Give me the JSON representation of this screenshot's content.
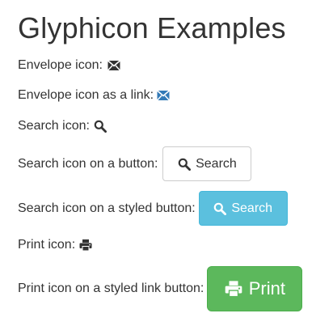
{
  "page": {
    "title": "Glyphicon Examples"
  },
  "rows": {
    "envelope": {
      "label": "Envelope icon:",
      "icon": "envelope-icon"
    },
    "envelope_link": {
      "label": "Envelope icon as a link:",
      "icon": "envelope-icon"
    },
    "search": {
      "label": "Search icon:",
      "icon": "search-icon"
    },
    "search_button": {
      "label": "Search icon on a button:",
      "button_label": "Search",
      "icon": "search-icon"
    },
    "search_styled_button": {
      "label": "Search icon on a styled button:",
      "button_label": "Search",
      "icon": "search-icon"
    },
    "print": {
      "label": "Print icon:",
      "icon": "print-icon"
    },
    "print_link_button": {
      "label": "Print icon on a styled link button:",
      "button_label": "Print",
      "icon": "print-icon"
    }
  },
  "colors": {
    "text": "#333333",
    "link": "#337ab7",
    "info_button": "#5bc0de",
    "success_button": "#5cb85c"
  }
}
